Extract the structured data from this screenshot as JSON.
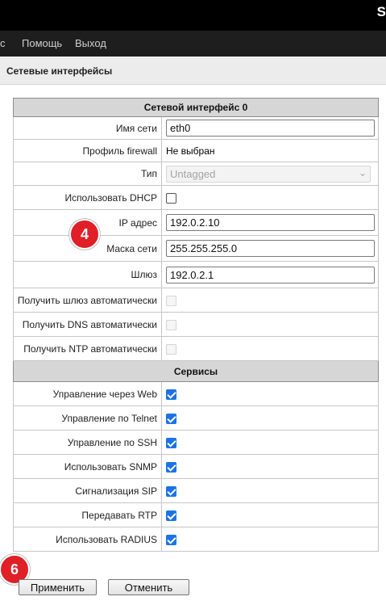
{
  "header": {
    "brand_fragment": "S"
  },
  "menu": {
    "item0": "с",
    "item1": "Помощь",
    "item2": "Выход"
  },
  "page_title": "Сетевые интерфейсы",
  "interface_section": {
    "title": "Сетевой интерфейс 0"
  },
  "fields": {
    "network_name": {
      "label": "Имя сети",
      "value": "eth0"
    },
    "firewall_profile": {
      "label": "Профиль firewall",
      "value": "Не выбран"
    },
    "type": {
      "label": "Тип",
      "value": "Untagged"
    },
    "use_dhcp": {
      "label": "Использовать DHCP",
      "checked": false
    },
    "ip_address": {
      "label": "IP адрес",
      "value": "192.0.2.10"
    },
    "netmask": {
      "label": "Маска сети",
      "value": "255.255.255.0"
    },
    "gateway": {
      "label": "Шлюз",
      "value": "192.0.2.1"
    },
    "auto_gateway": {
      "label": "Получить шлюз автоматически",
      "checked": false,
      "disabled": true
    },
    "auto_dns": {
      "label": "Получить DNS автоматически",
      "checked": false,
      "disabled": true
    },
    "auto_ntp": {
      "label": "Получить NTP автоматически",
      "checked": false,
      "disabled": true
    }
  },
  "services_section": {
    "title": "Сервисы"
  },
  "services": [
    {
      "label": "Управление через Web",
      "checked": true
    },
    {
      "label": "Управление по Telnet",
      "checked": true
    },
    {
      "label": "Управление по SSH",
      "checked": true
    },
    {
      "label": "Использовать SNMP",
      "checked": true
    },
    {
      "label": "Сигнализация SIP",
      "checked": true
    },
    {
      "label": "Передавать RTP",
      "checked": true
    },
    {
      "label": "Использовать RADIUS",
      "checked": true
    }
  ],
  "buttons": {
    "apply": "Применить",
    "cancel": "Отменить"
  },
  "annotations": {
    "marker_ip": "4",
    "marker_apply": "6"
  },
  "colors": {
    "marker": "#e01f26",
    "checkbox_checked": "#1a73e8",
    "section_header": "#d6d6d6",
    "topbar": "#000000"
  }
}
